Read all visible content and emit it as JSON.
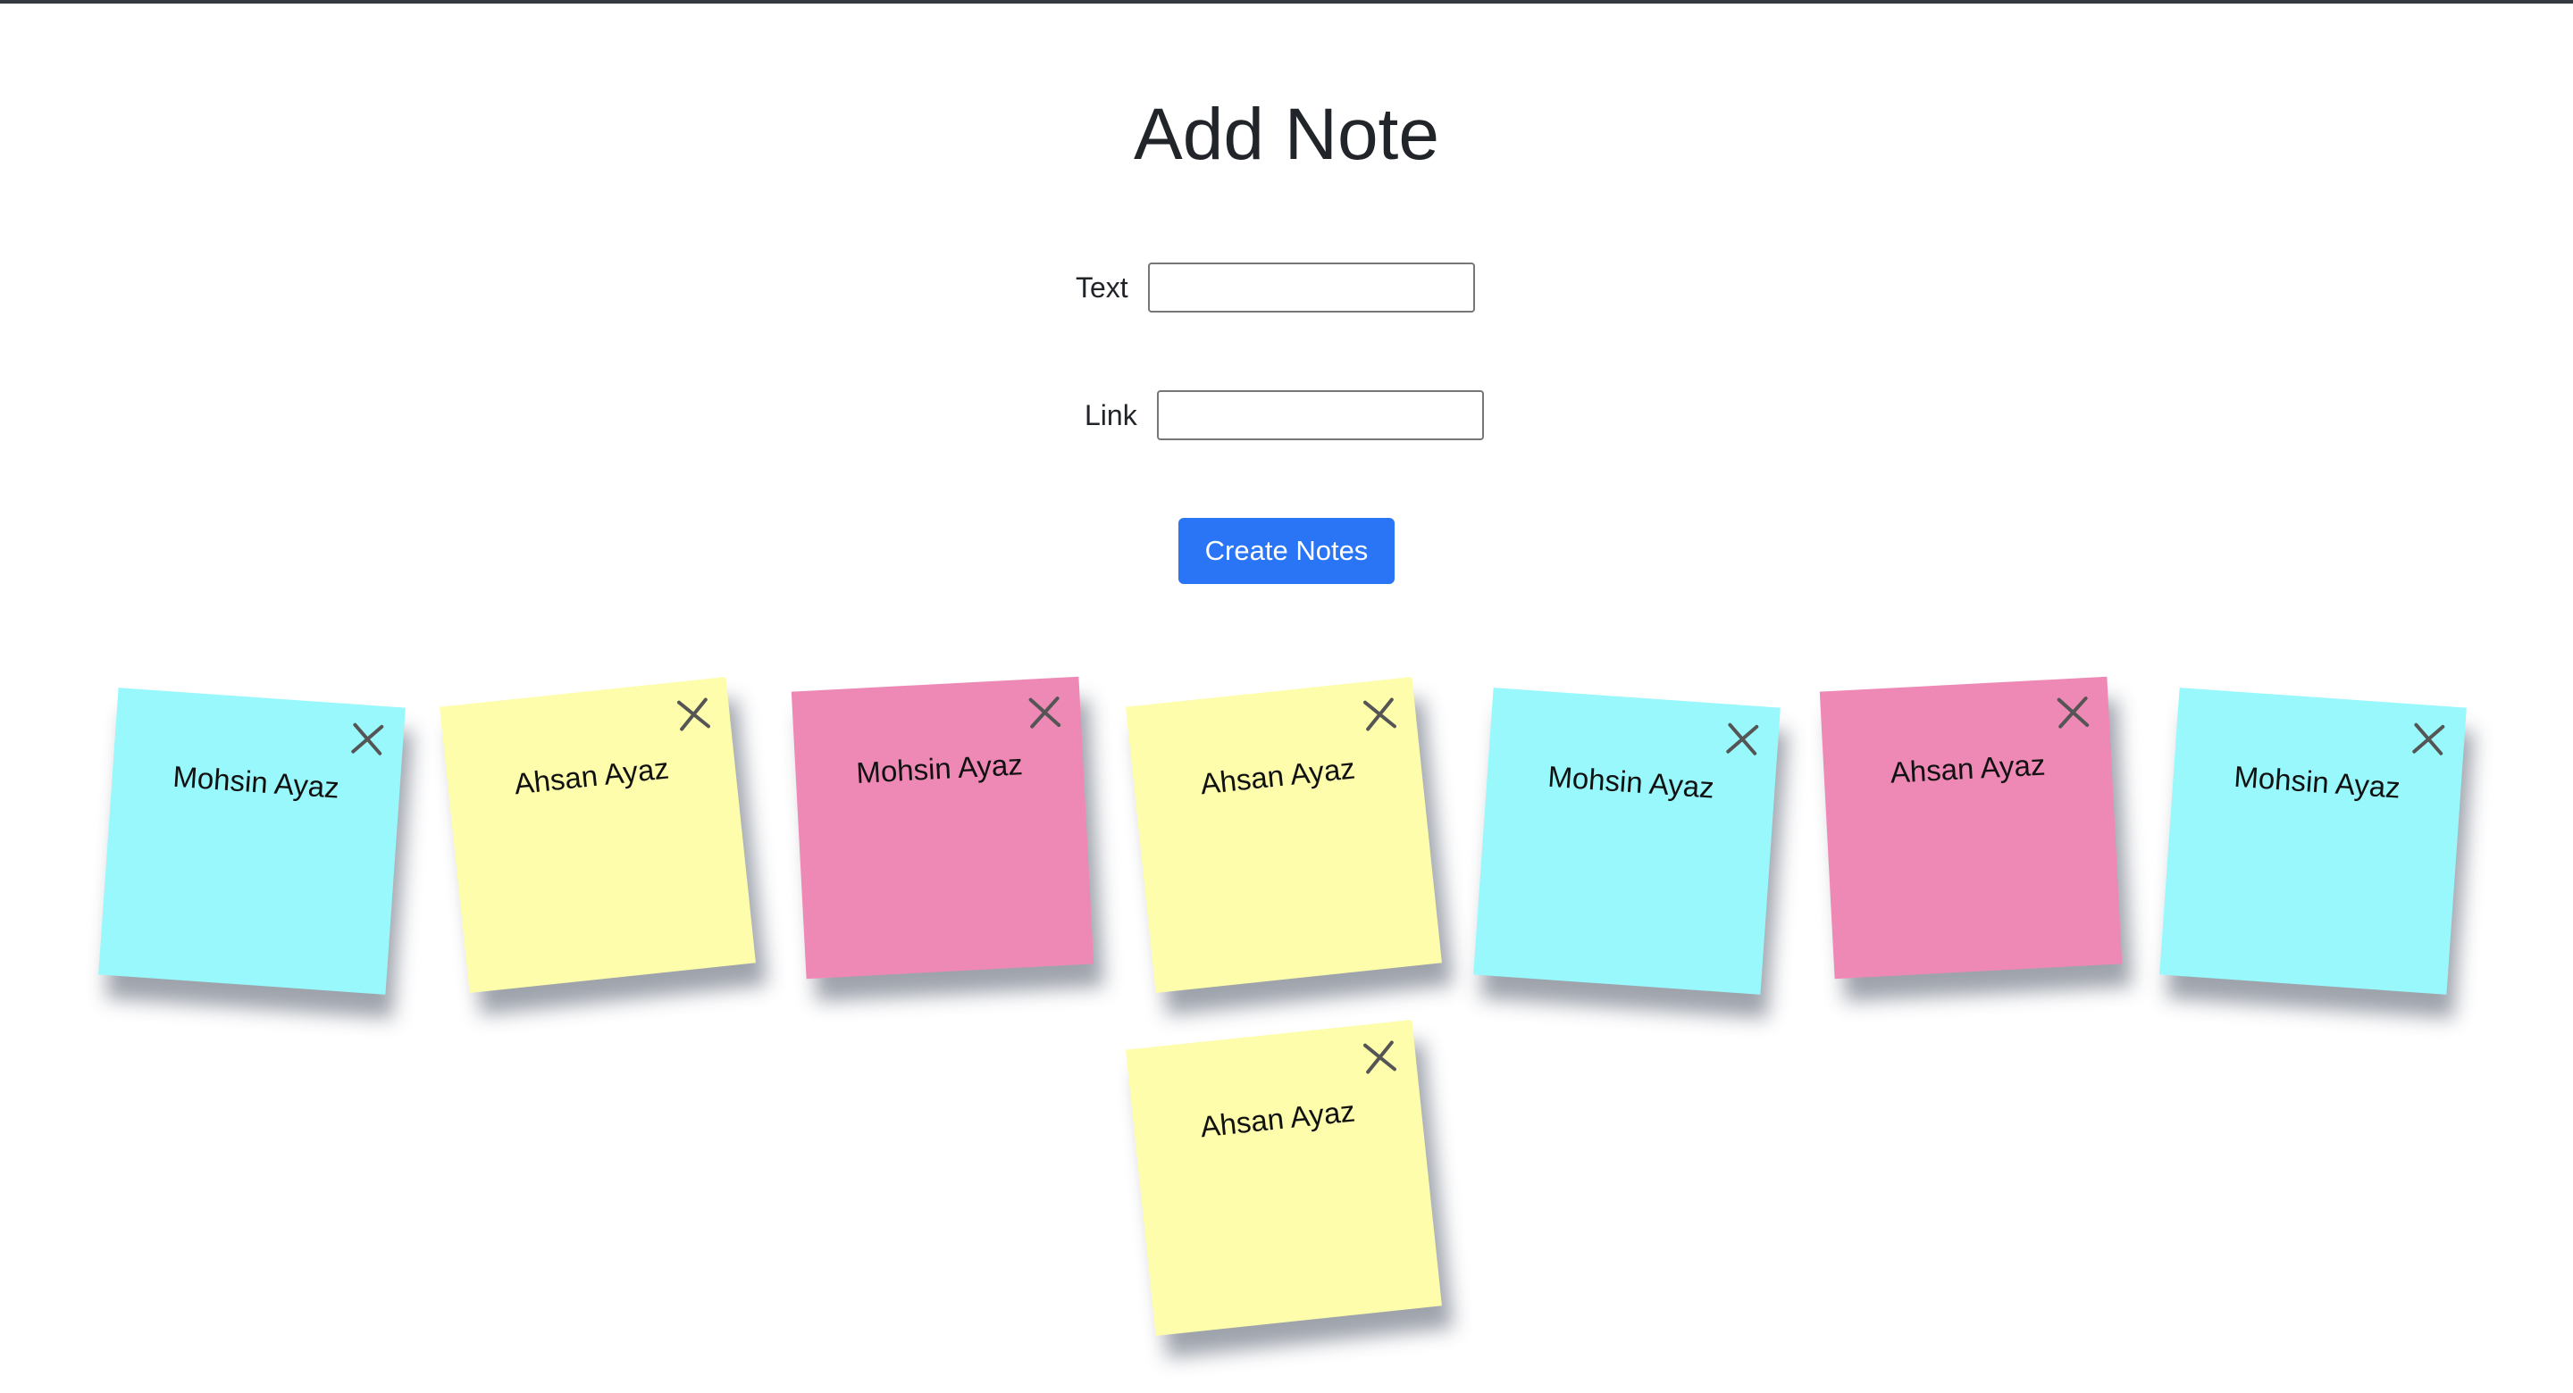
{
  "form": {
    "title": "Add Note",
    "text_label": "Text",
    "text_value": "",
    "link_label": "Link",
    "link_value": "",
    "submit_label": "Create Notes"
  },
  "notes": [
    {
      "text": "Mohsin Ayaz",
      "color": "#99f8fb"
    },
    {
      "text": "Ahsan Ayaz",
      "color": "#fdfdab"
    },
    {
      "text": "Mohsin Ayaz",
      "color": "#ee89b6"
    },
    {
      "text": "Ahsan Ayaz",
      "color": "#fdfdab"
    },
    {
      "text": "Mohsin Ayaz",
      "color": "#99f8fb"
    },
    {
      "text": "Ahsan Ayaz",
      "color": "#ee89b6"
    },
    {
      "text": "Mohsin Ayaz",
      "color": "#99f8fb"
    },
    {
      "text": "Ahsan Ayaz",
      "color": "#fdfdab"
    }
  ],
  "colors": {
    "button": "#2a74f6",
    "close_icon": "#555555"
  }
}
